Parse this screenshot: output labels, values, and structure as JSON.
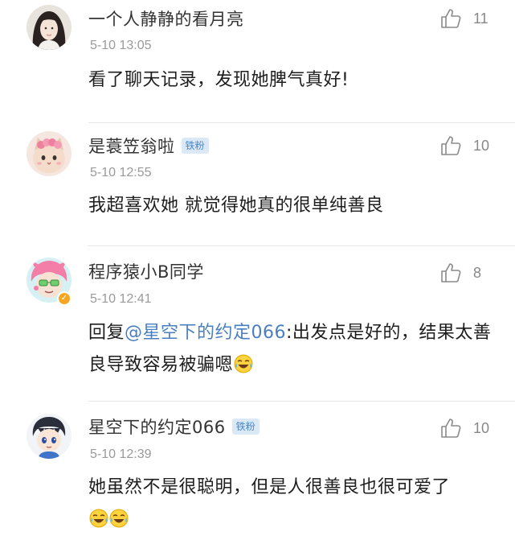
{
  "comments": [
    {
      "username": "一个人静静的看月亮",
      "badge": "",
      "timestamp": "5-10 13:05",
      "text": "看了聊天记录，发现她脾气真好!",
      "likes": "11",
      "avatar_icon": "girl-portrait-avatar"
    },
    {
      "username": "是蓑笠翁啦",
      "badge": "铁粉",
      "timestamp": "5-10 12:55",
      "text": "我超喜欢她 就觉得她真的很单纯善良",
      "likes": "10",
      "avatar_icon": "cat-avatar"
    },
    {
      "username": "程序猿小B同学",
      "badge": "",
      "timestamp": "5-10 12:41",
      "reply_prefix": "回复",
      "mention": "@星空下的约定066",
      "text": ":出发点是好的，结果太善良导致容易被骗嗯",
      "likes": "8",
      "avatar_icon": "anime-pink-hair-avatar",
      "verified_icon": "verified-badge-icon"
    },
    {
      "username": "星空下的约定066",
      "badge": "铁粉",
      "timestamp": "5-10 12:39",
      "text": "她虽然不是很聪明，但是人很善良也很可爱了",
      "likes": "10",
      "avatar_icon": "anime-boy-avatar"
    }
  ],
  "colors": {
    "mention": "#4a7fbf",
    "badge_bg": "#dbe9f7",
    "badge_text": "#4a86c5",
    "timestamp": "#9a9a9a"
  }
}
